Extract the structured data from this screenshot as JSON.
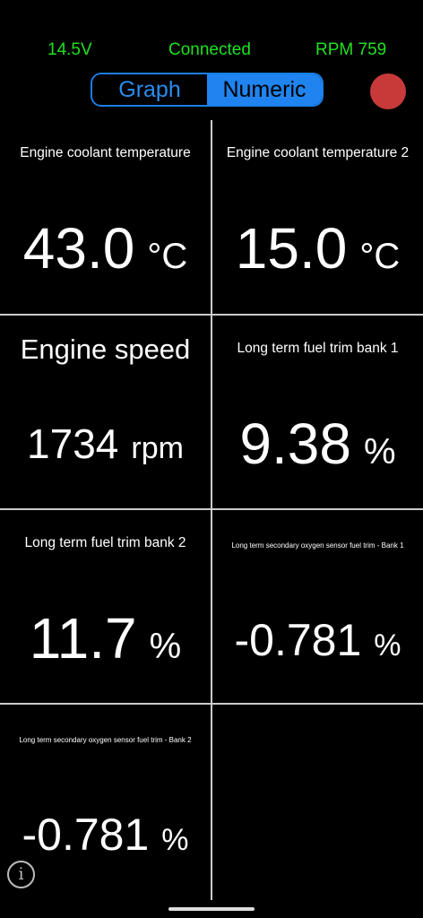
{
  "status": {
    "voltage": "14.5V",
    "connection": "Connected",
    "rpm": "RPM 759",
    "color": "#21e021"
  },
  "toggle": {
    "graph_label": "Graph",
    "numeric_label": "Numeric",
    "selected": "Numeric",
    "accent": "#1f84f0"
  },
  "record_button": {
    "color": "#c83a3a"
  },
  "gauges": [
    {
      "label": "Engine coolant temperature",
      "value": "43.0",
      "unit": "°C"
    },
    {
      "label": "Engine coolant temperature 2",
      "value": "15.0",
      "unit": "°C"
    },
    {
      "label": "Engine speed",
      "value": "1734",
      "unit": "rpm"
    },
    {
      "label": "Long term fuel trim bank 1",
      "value": "9.38",
      "unit": "%"
    },
    {
      "label": "Long term fuel trim bank 2",
      "value": "11.7",
      "unit": "%"
    },
    {
      "label": "Long term secondary oxygen sensor fuel trim  -  Bank 1",
      "value": "-0.781",
      "unit": "%"
    },
    {
      "label": "Long term secondary oxygen sensor fuel trim  -  Bank 2",
      "value": "-0.781",
      "unit": "%"
    }
  ],
  "info_icon": "info-icon"
}
